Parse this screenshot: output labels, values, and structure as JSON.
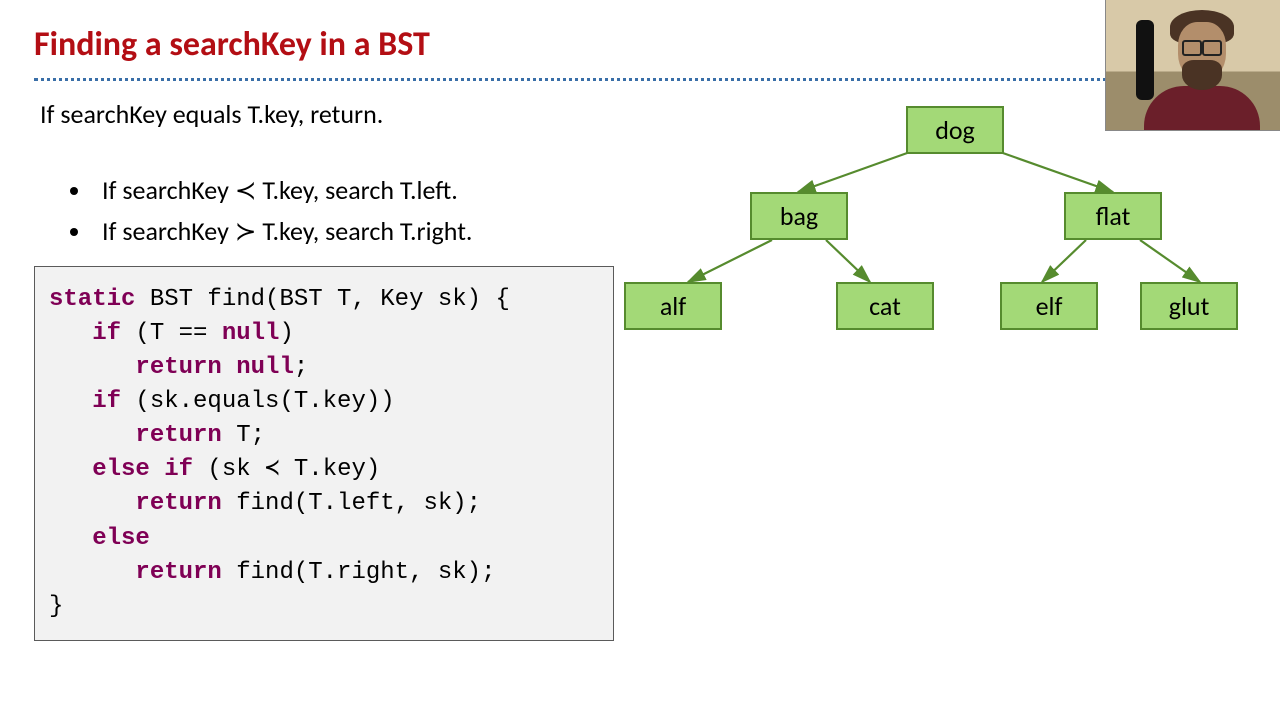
{
  "title": "Finding a searchKey in a BST",
  "intro": "If searchKey equals T.key, return.",
  "bullets": [
    {
      "pre": "If searchKey ",
      "op": "≺",
      "post": " T.key, search T.left."
    },
    {
      "pre": "If searchKey ",
      "op": "≻",
      "post": " T.key, search T.right."
    }
  ],
  "code": {
    "l1a": "static",
    "l1b": " BST find(BST T, Key sk) {",
    "l2a": "   if",
    "l2b": " (T == ",
    "l2c": "null",
    "l2d": ")",
    "l3a": "      return",
    "l3b": " ",
    "l3c": "null",
    "l3d": ";",
    "l4a": "   if",
    "l4b": " (sk.equals(T.key))",
    "l5a": "      return",
    "l5b": " T;",
    "l6a": "   else if",
    "l6b": " (sk ≺ T.key)",
    "l7a": "      return",
    "l7b": " find(T.left, sk);",
    "l8a": "   else",
    "l9a": "      return",
    "l9b": " find(T.right, sk);",
    "l10": "}"
  },
  "tree": {
    "root": "dog",
    "left": "bag",
    "right": "flat",
    "ll": "alf",
    "lr": "cat",
    "rl": "elf",
    "rr": "glut"
  }
}
